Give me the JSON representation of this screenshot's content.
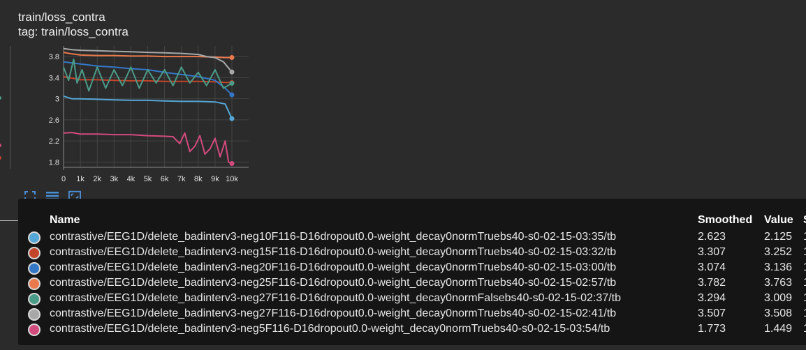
{
  "card": {
    "title": "train/loss_contra",
    "tag": "tag: train/loss_contra"
  },
  "toolbar": {
    "icons": [
      "fullscreen-icon",
      "toggle-log-icon",
      "fit-domain-icon"
    ]
  },
  "chart_data": {
    "type": "line",
    "x_ticks": [
      "0",
      "1k",
      "2k",
      "3k",
      "4k",
      "5k",
      "6k",
      "7k",
      "8k",
      "9k",
      "10k"
    ],
    "y_ticks": [
      "3.8",
      "3.4",
      "3",
      "2.6",
      "2.2",
      "1.8"
    ],
    "xlim": [
      0,
      10000
    ],
    "ylim": [
      1.7,
      4.0
    ],
    "grid": true,
    "series": [
      {
        "color": "#56a7d6",
        "x": [
          0,
          500,
          1000,
          2000,
          3000,
          4000,
          5000,
          6000,
          7000,
          8000,
          9000,
          9600,
          10000
        ],
        "y": [
          3.05,
          3.0,
          3.0,
          2.99,
          2.98,
          2.97,
          2.97,
          2.96,
          2.95,
          2.95,
          2.94,
          2.9,
          2.623
        ]
      },
      {
        "color": "#c3452a",
        "x": [
          0,
          500,
          1000,
          2000,
          3000,
          4000,
          5000,
          6000,
          7000,
          8000,
          9000,
          9600,
          10000
        ],
        "y": [
          3.42,
          3.39,
          3.36,
          3.36,
          3.35,
          3.34,
          3.34,
          3.33,
          3.33,
          3.33,
          3.32,
          3.31,
          3.307
        ]
      },
      {
        "color": "#3477c6",
        "x": [
          0,
          500,
          1000,
          2000,
          3000,
          4000,
          5000,
          6000,
          7000,
          8000,
          9000,
          9600,
          10000
        ],
        "y": [
          3.7,
          3.68,
          3.66,
          3.62,
          3.6,
          3.57,
          3.55,
          3.5,
          3.46,
          3.42,
          3.35,
          3.2,
          3.074
        ]
      },
      {
        "color": "#ea7a4e",
        "x": [
          0,
          500,
          1000,
          2000,
          3000,
          4000,
          5000,
          6000,
          7000,
          8000,
          9000,
          9600,
          10000
        ],
        "y": [
          3.88,
          3.85,
          3.83,
          3.82,
          3.82,
          3.81,
          3.81,
          3.8,
          3.8,
          3.8,
          3.79,
          3.78,
          3.782
        ]
      },
      {
        "color": "#4a9c88",
        "x": [
          0,
          300,
          600,
          800,
          1100,
          1500,
          2000,
          2500,
          3000,
          3500,
          4000,
          4500,
          5000,
          5500,
          6000,
          6500,
          7000,
          7500,
          8000,
          8500,
          9000,
          9500,
          10000
        ],
        "y": [
          3.6,
          3.35,
          3.75,
          3.3,
          3.55,
          3.15,
          3.6,
          3.2,
          3.55,
          3.25,
          3.6,
          3.2,
          3.55,
          3.3,
          3.55,
          3.25,
          3.6,
          3.3,
          3.5,
          3.25,
          3.55,
          3.2,
          3.294
        ]
      },
      {
        "color": "#a8a8a8",
        "x": [
          0,
          500,
          1000,
          2000,
          3000,
          4000,
          5000,
          6000,
          7000,
          8000,
          8500,
          9000,
          9500,
          10000
        ],
        "y": [
          3.95,
          3.93,
          3.92,
          3.91,
          3.9,
          3.89,
          3.88,
          3.87,
          3.86,
          3.84,
          3.8,
          3.78,
          3.7,
          3.507
        ]
      },
      {
        "color": "#d34b7d",
        "x": [
          0,
          500,
          1000,
          2000,
          3000,
          4000,
          5000,
          6000,
          6500,
          6900,
          7200,
          7500,
          7800,
          8100,
          8400,
          8700,
          9000,
          9300,
          9600,
          9800,
          10000
        ],
        "y": [
          2.35,
          2.36,
          2.33,
          2.33,
          2.32,
          2.32,
          2.3,
          2.29,
          2.28,
          2.15,
          2.35,
          2.0,
          2.1,
          2.3,
          1.95,
          2.05,
          2.25,
          1.9,
          2.2,
          1.8,
          1.773
        ]
      }
    ]
  },
  "tooltip": {
    "headers": {
      "name": "Name",
      "smoothed": "Smoothed",
      "value": "Value",
      "extra": "S"
    },
    "rows": [
      {
        "color": "#56a7d6",
        "name": "contrastive/EEG1D/delete_badinterv3-neg10F116-D16dropout0.0-weight_decay0normTruebs40-s0-02-15-03:35/tb",
        "smoothed": "2.623",
        "value": "2.125",
        "extra": "1"
      },
      {
        "color": "#c3452a",
        "name": "contrastive/EEG1D/delete_badinterv3-neg15F116-D16dropout0.0-weight_decay0normTruebs40-s0-02-15-03:32/tb",
        "smoothed": "3.307",
        "value": "3.252",
        "extra": "1"
      },
      {
        "color": "#3477c6",
        "name": "contrastive/EEG1D/delete_badinterv3-neg20F116-D16dropout0.0-weight_decay0normTruebs40-s0-02-15-03:00/tb",
        "smoothed": "3.074",
        "value": "3.136",
        "extra": "1"
      },
      {
        "color": "#ea7a4e",
        "name": "contrastive/EEG1D/delete_badinterv3-neg25F116-D16dropout0.0-weight_decay0normTruebs40-s0-02-15-02:57/tb",
        "smoothed": "3.782",
        "value": "3.763",
        "extra": "1"
      },
      {
        "color": "#4a9c88",
        "name": "contrastive/EEG1D/delete_badinterv3-neg27F116-D16dropout0.0-weight_decay0normFalsebs40-s0-02-15-02:37/tb",
        "smoothed": "3.294",
        "value": "3.009",
        "extra": "1"
      },
      {
        "color": "#a8a8a8",
        "name": "contrastive/EEG1D/delete_badinterv3-neg27F116-D16dropout0.0-weight_decay0normTruebs40-s0-02-15-02:41/tb",
        "smoothed": "3.507",
        "value": "3.508",
        "extra": "1"
      },
      {
        "color": "#d34b7d",
        "name": "contrastive/EEG1D/delete_badinterv3-neg5F116-D16dropout0.0-weight_decay0normTruebs40-s0-02-15-03:54/tb",
        "smoothed": "1.773",
        "value": "1.449",
        "extra": "1"
      }
    ]
  }
}
